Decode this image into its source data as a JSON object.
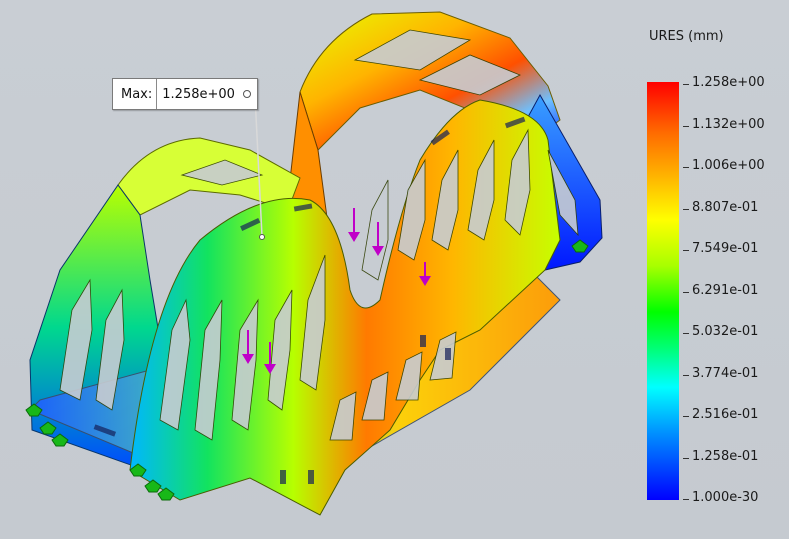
{
  "annotation": {
    "max_tag": "Max:",
    "max_value": "1.258e+00"
  },
  "legend": {
    "title": "URES (mm)",
    "values": [
      "1.258e+00",
      "1.132e+00",
      "1.006e+00",
      "8.807e-01",
      "7.549e-01",
      "6.291e-01",
      "5.032e-01",
      "3.774e-01",
      "2.516e-01",
      "1.258e-01",
      "1.000e-30"
    ],
    "colors": [
      "#ff0000",
      "#ff6a00",
      "#ffb000",
      "#ffff00",
      "#a8ff00",
      "#00ff00",
      "#00ff7a",
      "#00ffff",
      "#0090ff",
      "#0000ff"
    ]
  },
  "icons": {
    "fixture": "fixture-anchor-icon",
    "load": "force-arrow-icon"
  }
}
